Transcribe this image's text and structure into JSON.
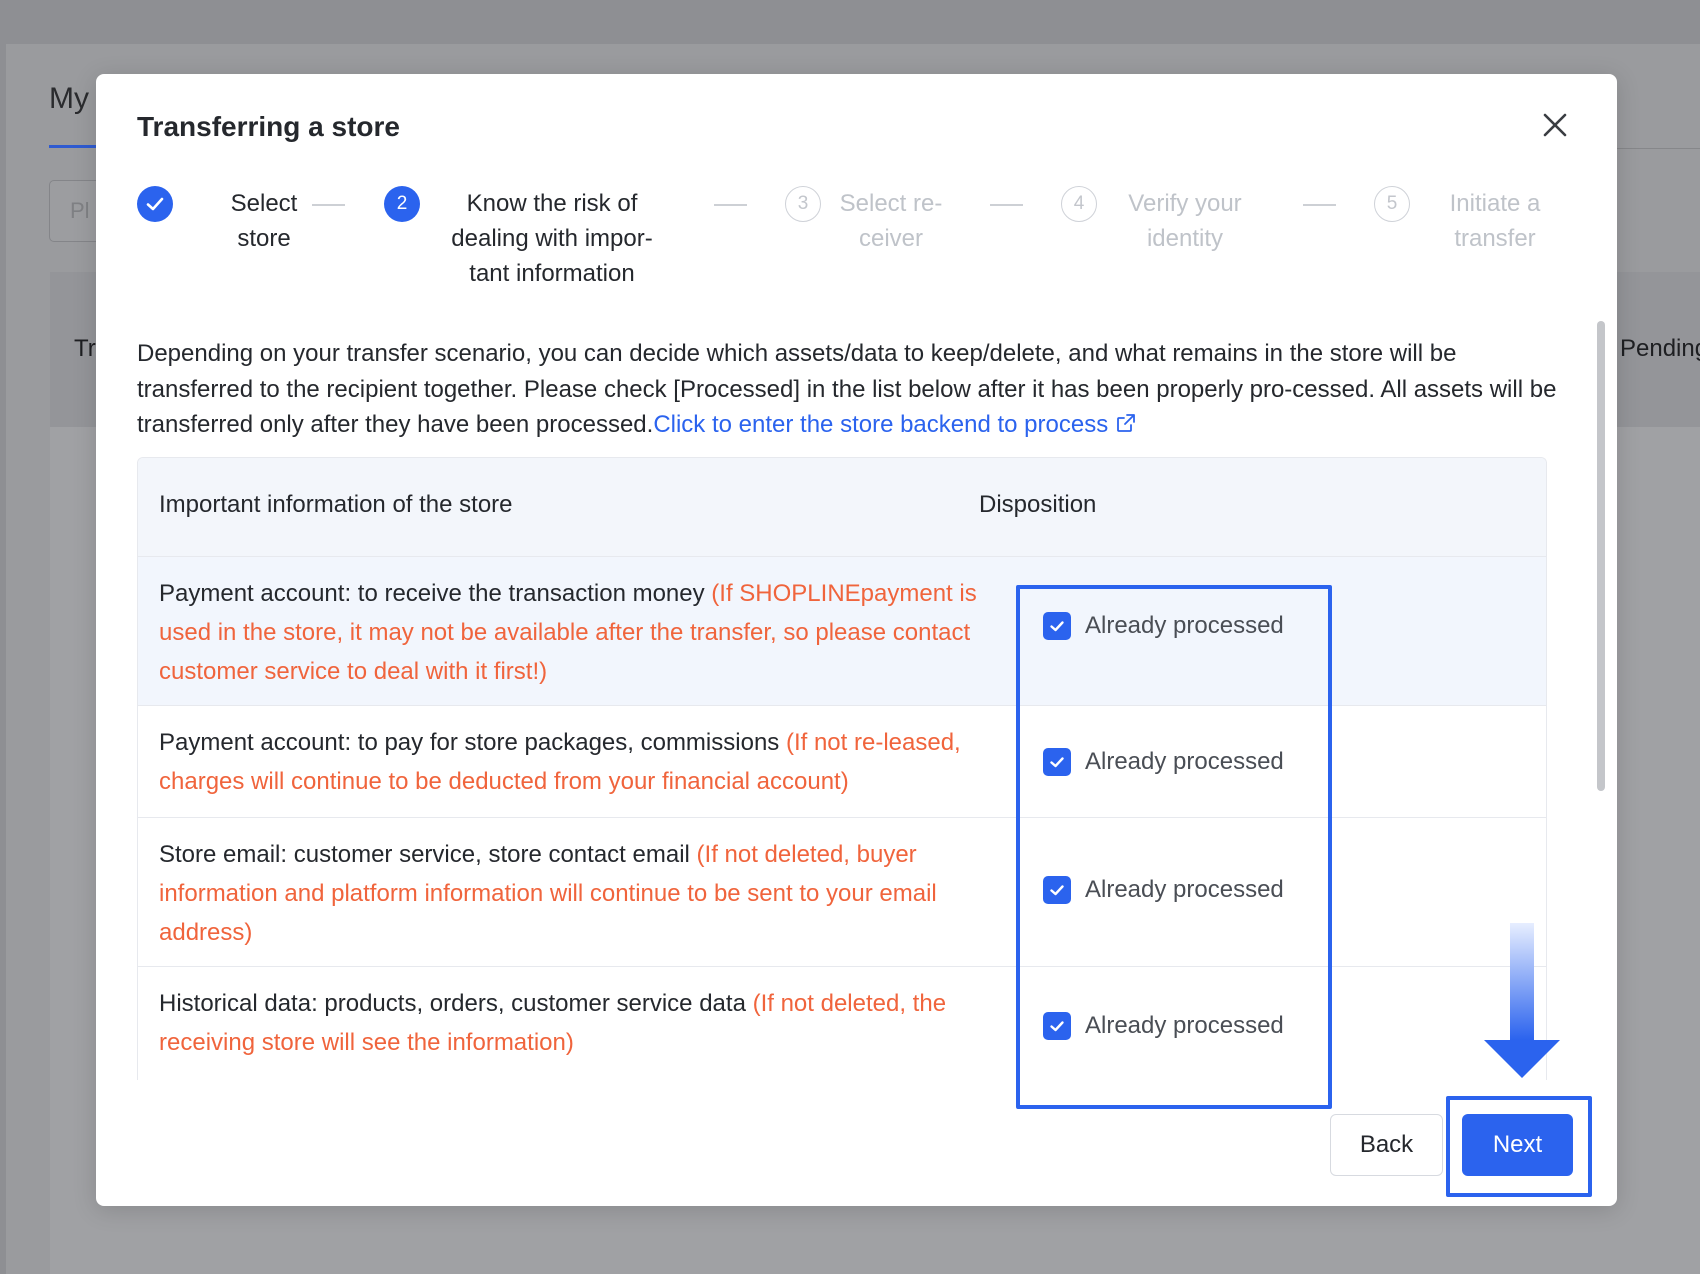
{
  "background": {
    "title": "My",
    "input_placeholder": "Pl",
    "table_head_left": "Tr",
    "table_head_right": "Pending"
  },
  "modal": {
    "title": "Transferring a store",
    "close_icon": "close-icon",
    "steps": [
      {
        "number": "1",
        "status": "done",
        "label_lines": [
          "Select",
          "store"
        ]
      },
      {
        "number": "2",
        "status": "active",
        "label_lines": [
          "Know the risk of",
          "dealing with impor-",
          "tant information"
        ]
      },
      {
        "number": "3",
        "status": "wait",
        "label_lines": [
          "Select re-",
          "ceiver"
        ]
      },
      {
        "number": "4",
        "status": "wait",
        "label_lines": [
          "Verify your",
          "identity"
        ]
      },
      {
        "number": "5",
        "status": "wait",
        "label_lines": [
          "Initiate a",
          "transfer"
        ]
      }
    ],
    "intro_text": "Depending on your transfer scenario, you can decide which assets/data to keep/delete, and what remains in the store will be transferred to the recipient together. Please check [Processed] in the list below after it has been properly pro-cessed. All assets will be transferred only after they have been processed.",
    "intro_link": "Click to enter the store backend to process",
    "intro_link_icon": "external-link-icon",
    "table": {
      "columns": [
        "Important information of the store",
        "Disposition"
      ],
      "rows": [
        {
          "info": "Payment account: to receive the transaction money ",
          "warning": "(If SHOPLINEpayment is used in the store, it may not be available after the transfer, so please contact customer service to deal with it first!)",
          "disposition": "Already processed",
          "checked": true
        },
        {
          "info": "Payment account: to pay for store packages, commissions ",
          "warning": "(If not re-leased, charges will continue to be deducted from your financial account)",
          "disposition": "Already processed",
          "checked": true
        },
        {
          "info": "Store email: customer service, store contact email ",
          "warning": "(If not deleted, buyer information and platform information will continue to be sent to your email address)",
          "disposition": "Already processed",
          "checked": true
        },
        {
          "info": "Historical data: products, orders, customer service data ",
          "warning": "(If not deleted, the receiving store will see the information)",
          "disposition": "Already processed",
          "checked": true
        }
      ]
    },
    "buttons": {
      "back": "Back",
      "next": "Next"
    },
    "accent_color": "#2b63ee",
    "warning_color": "#f0643c"
  }
}
